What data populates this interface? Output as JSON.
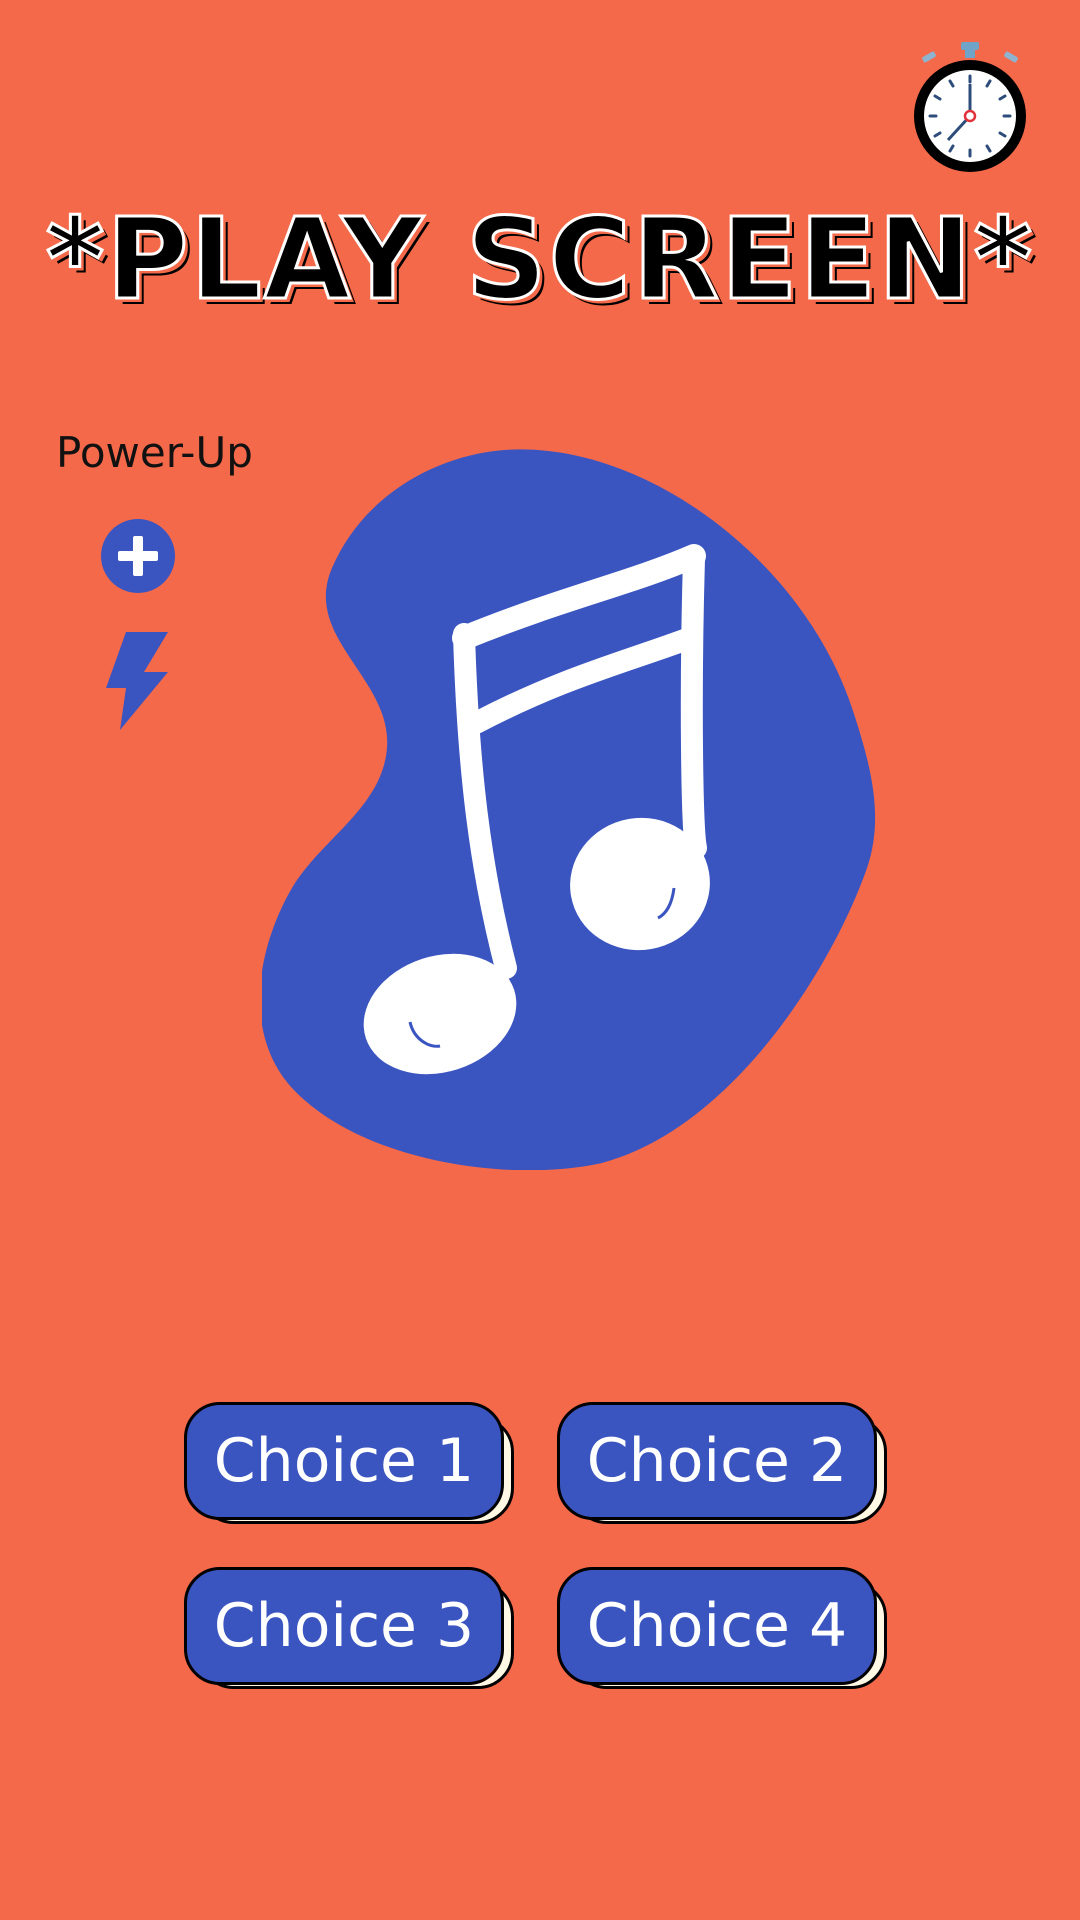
{
  "title": "*PLAY SCREEN*",
  "powerup": {
    "label": "Power-Up",
    "items": [
      {
        "icon": "plus-icon"
      },
      {
        "icon": "lightning-bolt-icon"
      }
    ]
  },
  "timer": {
    "icon": "stopwatch-icon"
  },
  "main_image": {
    "icon": "music-note-icon"
  },
  "choices": [
    {
      "label": "Choice 1"
    },
    {
      "label": "Choice 2"
    },
    {
      "label": "Choice 3"
    },
    {
      "label": "Choice 4"
    }
  ],
  "colors": {
    "background": "#F4694A",
    "accent": "#3B55C0",
    "button_shadow": "#FFF8E4",
    "outline": "#000000"
  }
}
